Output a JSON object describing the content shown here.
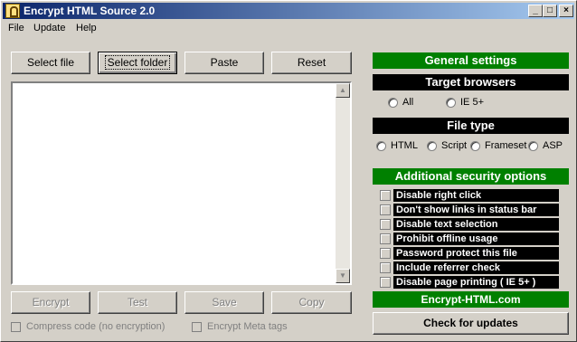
{
  "window": {
    "title": "Encrypt HTML Source 2.0"
  },
  "titlebar_buttons": {
    "minimize": "_",
    "maximize": "□",
    "close": "×"
  },
  "menu": [
    "File",
    "Update",
    "Help"
  ],
  "toolbar": {
    "select_file": "Select file",
    "select_folder": "Select folder",
    "paste": "Paste",
    "reset": "Reset"
  },
  "editor": {
    "value": ""
  },
  "actions": {
    "encrypt": "Encrypt",
    "test": "Test",
    "save": "Save",
    "copy": "Copy"
  },
  "options": {
    "compress": "Compress code (no encryption)",
    "encrypt_meta": "Encrypt Meta tags"
  },
  "general_settings": "General settings",
  "target_browsers": {
    "title": "Target browsers",
    "options": [
      "All",
      "IE 5+"
    ]
  },
  "file_type": {
    "title": "File type",
    "options": [
      "HTML",
      "Script",
      "Frameset",
      "ASP"
    ]
  },
  "security": {
    "title": "Additional security options",
    "items": [
      "Disable right click",
      "Don't show links in status bar",
      "Disable text selection",
      "Prohibit offline usage",
      "Password protect this file",
      "Include referrer check",
      "Disable page printing ( IE 5+ )"
    ]
  },
  "website": "Encrypt-HTML.com",
  "check_updates": "Check for updates",
  "colors": {
    "green": "#008000",
    "black": "#000000",
    "titlebar": "#0a246a"
  }
}
